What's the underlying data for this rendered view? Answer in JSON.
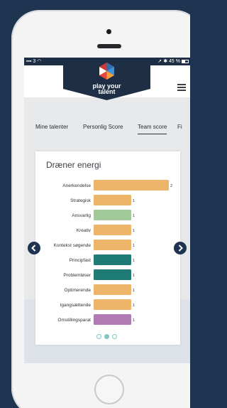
{
  "status_bar": {
    "signal": "3",
    "time": "12.24",
    "right": "45 %",
    "battery_level": 0.45
  },
  "app": {
    "brand_line1": "play your",
    "brand_line2": "talent"
  },
  "tabs": [
    {
      "label": "Mine talenter",
      "active": false
    },
    {
      "label": "Personlig Score",
      "active": false
    },
    {
      "label": "Team score",
      "active": true
    },
    {
      "label": "Fi",
      "active": false
    }
  ],
  "card": {
    "title": "Dræner energi"
  },
  "colors": {
    "orange": "#ecb56a",
    "green": "#a1c99a",
    "teal": "#1f7b76",
    "purple": "#b07cb3",
    "navy": "#1f3450",
    "dot": "#7fc6c4"
  },
  "chart_data": {
    "type": "bar",
    "orientation": "horizontal",
    "title": "Dræner energi",
    "categories": [
      "Anerkendelse",
      "Strategisk",
      "Ansvarlig",
      "Kreativ",
      "Kontekst søgende",
      "Principfast",
      "Problemløser",
      "Optimerende",
      "Igangsættende",
      "Omstillingsparat"
    ],
    "values": [
      2,
      1,
      1,
      1,
      1,
      1,
      1,
      1,
      1,
      1
    ],
    "value_labels": [
      "2",
      "1",
      "1",
      "1",
      "1",
      "1",
      "1",
      "1",
      "1",
      "1"
    ],
    "bar_colors": [
      "#ecb56a",
      "#ecb56a",
      "#a1c99a",
      "#ecb56a",
      "#ecb56a",
      "#1f7b76",
      "#1f7b76",
      "#ecb56a",
      "#ecb56a",
      "#b07cb3"
    ],
    "xlim": [
      0,
      2
    ]
  },
  "pager": {
    "count": 3,
    "active": 1
  }
}
